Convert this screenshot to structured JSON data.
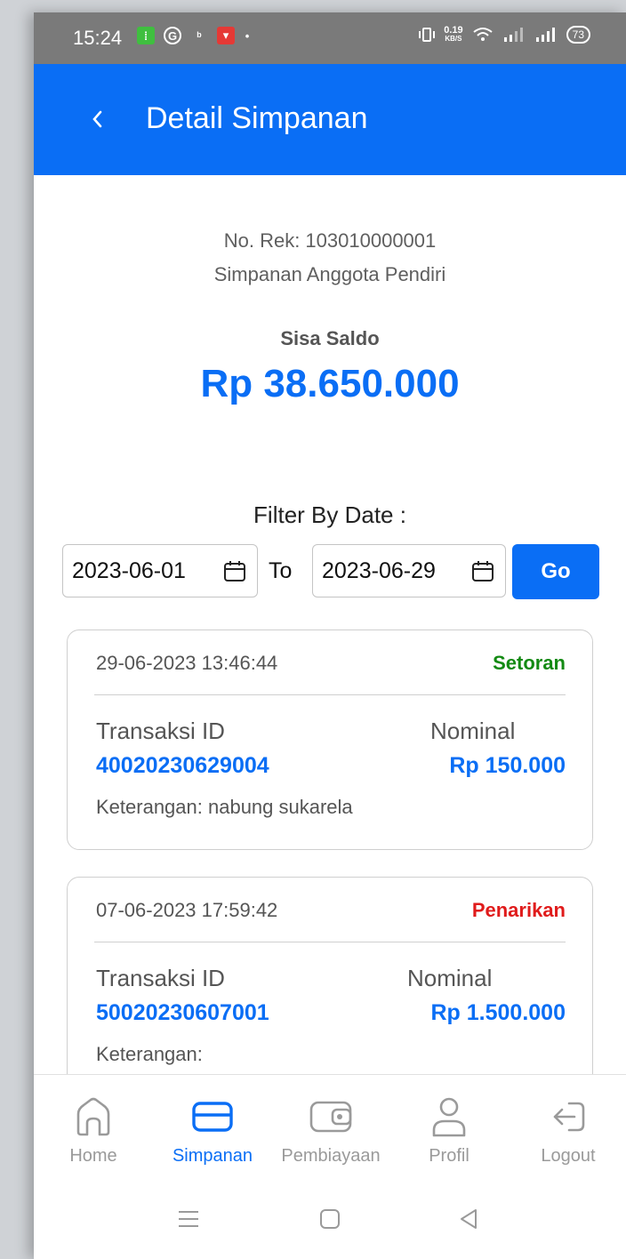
{
  "status_bar": {
    "time": "15:24",
    "net_speed": "0.19",
    "net_unit": "KB/S",
    "battery": "73"
  },
  "header": {
    "title": "Detail Simpanan"
  },
  "account": {
    "number_text": "No. Rek: 103010000001",
    "type": "Simpanan Anggota Pendiri",
    "balance_label": "Sisa Saldo",
    "balance": "Rp 38.650.000"
  },
  "filter": {
    "label": "Filter By Date :",
    "from": "2023-06-01",
    "to_label": "To",
    "to": "2023-06-29",
    "go_label": "Go"
  },
  "transactions": [
    {
      "datetime": "29-06-2023 13:46:44",
      "type": "Setoran",
      "type_color": "#138a13",
      "id_label": "Transaksi ID",
      "id": "40020230629004",
      "nominal_label": "Nominal",
      "nominal": "Rp 150.000",
      "keterangan": "Keterangan: nabung sukarela"
    },
    {
      "datetime": "07-06-2023 17:59:42",
      "type": "Penarikan",
      "type_color": "#e01b1b",
      "id_label": "Transaksi ID",
      "id": "50020230607001",
      "nominal_label": "Nominal",
      "nominal": "Rp 1.500.000",
      "keterangan": "Keterangan:"
    }
  ],
  "bottom_nav": {
    "items": [
      {
        "label": "Home",
        "icon": "home-icon",
        "active": false
      },
      {
        "label": "Simpanan",
        "icon": "card-icon",
        "active": true
      },
      {
        "label": "Pembiayaan",
        "icon": "wallet-icon",
        "active": false
      },
      {
        "label": "Profil",
        "icon": "user-icon",
        "active": false
      },
      {
        "label": "Logout",
        "icon": "logout-icon",
        "active": false
      }
    ]
  },
  "colors": {
    "primary": "#0a6ef5",
    "setoran": "#138a13",
    "penarikan": "#e01b1b"
  }
}
